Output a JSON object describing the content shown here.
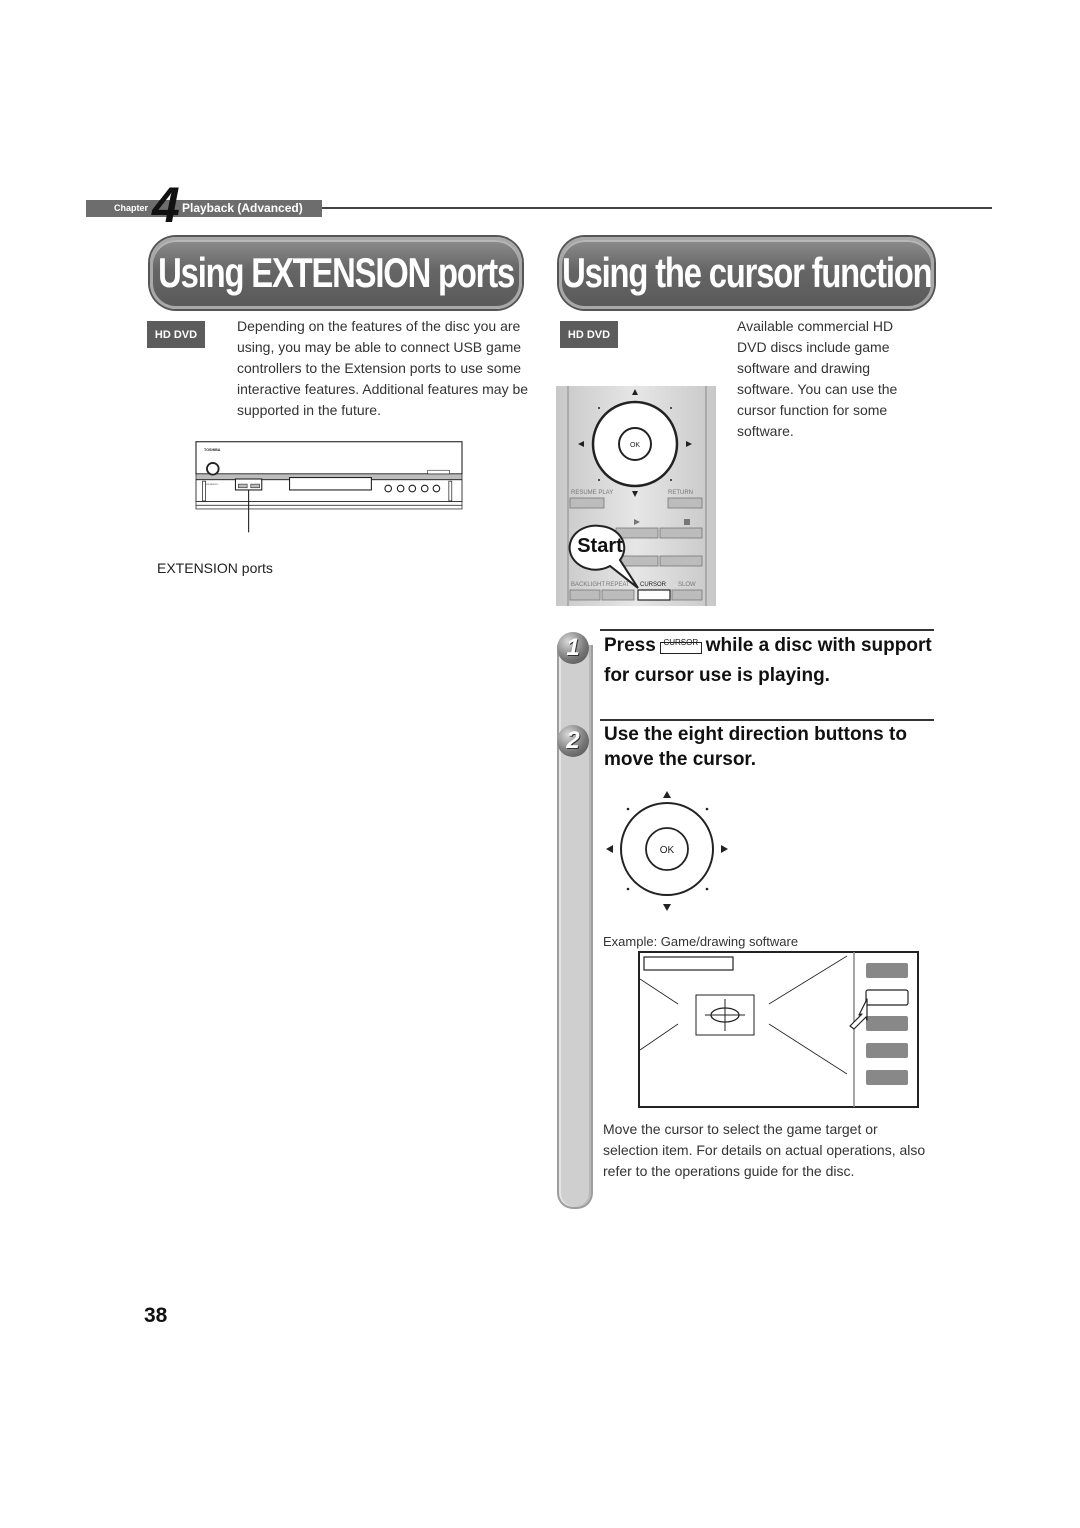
{
  "header": {
    "chapter_word": "Chapter",
    "chapter_number": "4",
    "chapter_title": "Playback (Advanced)"
  },
  "left_section": {
    "title": "Using EXTENSION ports",
    "badge": "HD DVD",
    "body": "Depending on the features of the disc you are using, you may be able to connect USB game controllers to the Extension ports to use some interactive features. Additional features may be supported in the future.",
    "illustration": {
      "brand": "TOSHIBA",
      "power_label": "ON/STANDBY",
      "extension_panel_label": "EXTENSION",
      "callout": "EXTENSION ports"
    }
  },
  "right_section": {
    "title": "Using the cursor function",
    "badge": "HD DVD",
    "body": "Available commercial HD DVD discs include game software and drawing software. You can use the cursor function for some software.",
    "remote": {
      "ok_label": "OK",
      "buttons": [
        "RESUME PLAY",
        "RETURN",
        "BACKLIGHT",
        "REPEAT",
        "CURSOR",
        "SLOW"
      ],
      "start_bubble": "Start"
    },
    "steps": [
      {
        "number": "1",
        "text_before": "Press",
        "key_label": "CURSOR",
        "text_after": "while a disc with support for cursor use is playing."
      },
      {
        "number": "2",
        "text": "Use the eight direction buttons to move the cursor."
      }
    ],
    "dpad_ok_label": "OK",
    "example_label": "Example: Game/drawing software",
    "caption": "Move the cursor to select the game target or selection item. For details on actual operations, also refer to the operations guide for the disc."
  },
  "footer": {
    "page_number": "38"
  }
}
